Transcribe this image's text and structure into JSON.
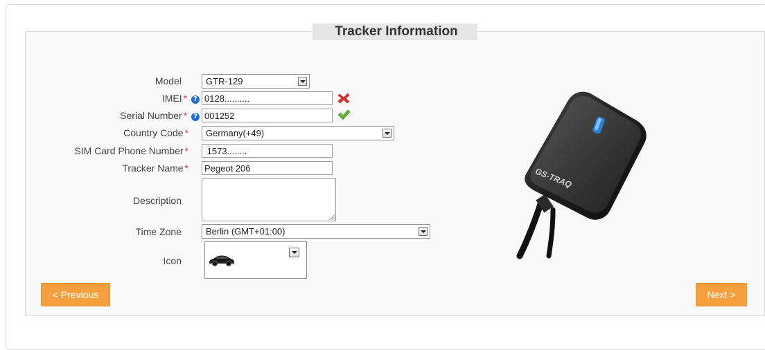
{
  "legend": "Tracker Information",
  "fields": {
    "model": {
      "label": "Model",
      "value": "GTR-129"
    },
    "imei": {
      "label": "IMEI",
      "required": "*",
      "value": "0128..........",
      "status": "invalid"
    },
    "serial": {
      "label": "Serial Number",
      "required": "*",
      "value": "001252",
      "status": "valid"
    },
    "country": {
      "label": "Country Code",
      "required": "*",
      "value": "Germany(+49)"
    },
    "sim": {
      "label": "SIM Card Phone Number",
      "required": "*",
      "value": " 1573........"
    },
    "tracker_name": {
      "label": "Tracker Name",
      "required": "*",
      "value": "Pegeot 206"
    },
    "description": {
      "label": "Description",
      "value": ""
    },
    "timezone": {
      "label": "Time Zone",
      "value": "Berlin (GMT+01:00)"
    },
    "icon": {
      "label": "Icon",
      "selected": "car-icon"
    }
  },
  "help_glyph": "?",
  "buttons": {
    "previous": "< Previous",
    "next": "Next >"
  },
  "device_brand": "GS-TRAQ",
  "colors": {
    "button": "#f5a03e",
    "required": "#e53935",
    "help": "#1e6fd0",
    "invalid": "#e0302a",
    "valid": "#6ab43a"
  }
}
